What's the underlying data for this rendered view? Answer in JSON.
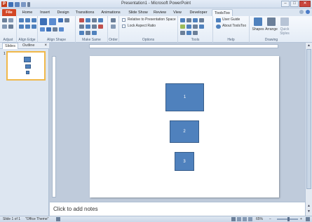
{
  "window": {
    "title": "Presentation1 - Microsoft PowerPoint",
    "controls": [
      "–",
      "□",
      "✕"
    ]
  },
  "tabs": [
    "File",
    "Home",
    "Insert",
    "Design",
    "Transitions",
    "Animations",
    "Slide Show",
    "Review",
    "View",
    "Developer",
    "ToolsToo"
  ],
  "active_tab": "ToolsToo",
  "ribbon": {
    "groups": [
      "Adjust",
      "Align Edge",
      "Align Shape",
      "Make Same",
      "Order",
      "Options",
      "Tools",
      "Help",
      "Drawing"
    ],
    "options": {
      "relative_label": "Relative to Presentation Space",
      "lock_label": "Lock Aspect Ratio"
    },
    "help": {
      "user_guide": "User Guide",
      "about": "About ToolsToo"
    },
    "drawing": {
      "shapes": "Shapes",
      "arrange": "Arrange",
      "quick_styles": "Quick Styles"
    }
  },
  "panel": {
    "tab_slides": "Slides",
    "tab_outline": "Outline",
    "close": "×",
    "slide_number": "1"
  },
  "slide": {
    "shapes": [
      {
        "label": "1"
      },
      {
        "label": "2"
      },
      {
        "label": "3"
      }
    ]
  },
  "notes": {
    "placeholder": "Click to add notes"
  },
  "status": {
    "slide_of": "Slide 1 of 1",
    "theme": "\"Office Theme\"",
    "zoom": "65%"
  },
  "colors": {
    "shape_fill": "#4f81bd",
    "file_tab": "#d24726"
  }
}
